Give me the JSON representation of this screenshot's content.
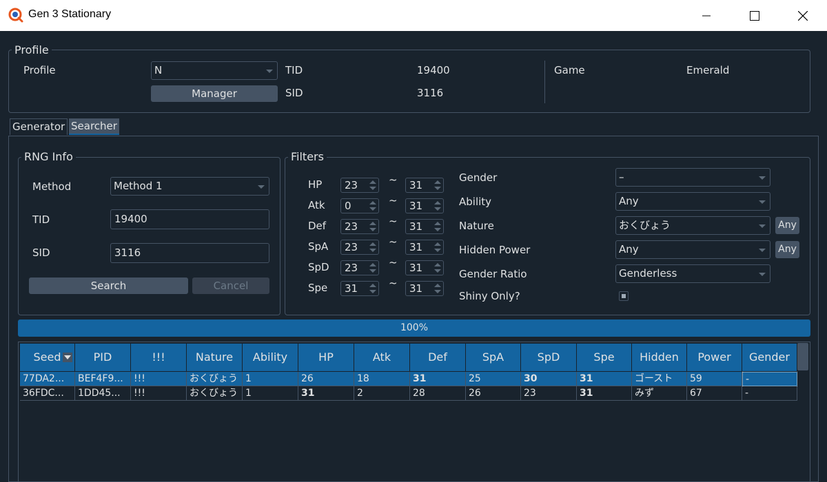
{
  "window": {
    "title": "Gen 3 Stationary"
  },
  "profile": {
    "section_title": "Profile",
    "profile_label": "Profile",
    "profile_value": "N",
    "manager_label": "Manager",
    "tid_label": "TID",
    "tid_value": "19400",
    "sid_label": "SID",
    "sid_value": "3116",
    "game_label": "Game",
    "game_value": "Emerald"
  },
  "tabs": [
    {
      "label": "Generator",
      "active": false
    },
    {
      "label": "Searcher",
      "active": true
    }
  ],
  "rng_info": {
    "section_title": "RNG Info",
    "method_label": "Method",
    "method_value": "Method 1",
    "tid_label": "TID",
    "tid_value": "19400",
    "sid_label": "SID",
    "sid_value": "3116",
    "search_label": "Search",
    "cancel_label": "Cancel"
  },
  "filters": {
    "section_title": "Filters",
    "tilde": "~",
    "ivs": [
      {
        "label": "HP",
        "min": "23",
        "max": "31"
      },
      {
        "label": "Atk",
        "min": "0",
        "max": "31"
      },
      {
        "label": "Def",
        "min": "23",
        "max": "31"
      },
      {
        "label": "SpA",
        "min": "23",
        "max": "31"
      },
      {
        "label": "SpD",
        "min": "23",
        "max": "31"
      },
      {
        "label": "Spe",
        "min": "31",
        "max": "31"
      }
    ],
    "gender_label": "Gender",
    "gender_value": "–",
    "ability_label": "Ability",
    "ability_value": "Any",
    "nature_label": "Nature",
    "nature_value": "おくびょう",
    "nature_any": "Any",
    "hidden_power_label": "Hidden Power",
    "hidden_power_value": "Any",
    "hidden_power_any": "Any",
    "gender_ratio_label": "Gender Ratio",
    "gender_ratio_value": "Genderless",
    "shiny_only_label": "Shiny Only?",
    "shiny_only_checked": true
  },
  "progress": {
    "value": 1.0,
    "label": "100%"
  },
  "results": {
    "columns": [
      "Seed",
      "PID",
      "!!!",
      "Nature",
      "Ability",
      "HP",
      "Atk",
      "Def",
      "SpA",
      "SpD",
      "Spe",
      "Hidden",
      "Power",
      "Gender"
    ],
    "rows": [
      [
        "77DA2...",
        "BEF4F9...",
        "!!!",
        "おくびょう",
        "1",
        "26",
        "18",
        "31",
        "25",
        "30",
        "31",
        "ゴースト",
        "59",
        "-"
      ],
      [
        "36FDC...",
        "1DD45...",
        "!!!",
        "おくびょう",
        "1",
        "31",
        "2",
        "28",
        "26",
        "23",
        "31",
        "みず",
        "67",
        "-"
      ]
    ]
  },
  "colors": {
    "background": "#19232d",
    "accent": "#1464a0",
    "border": "#455364",
    "text": "#dfe1e2"
  }
}
